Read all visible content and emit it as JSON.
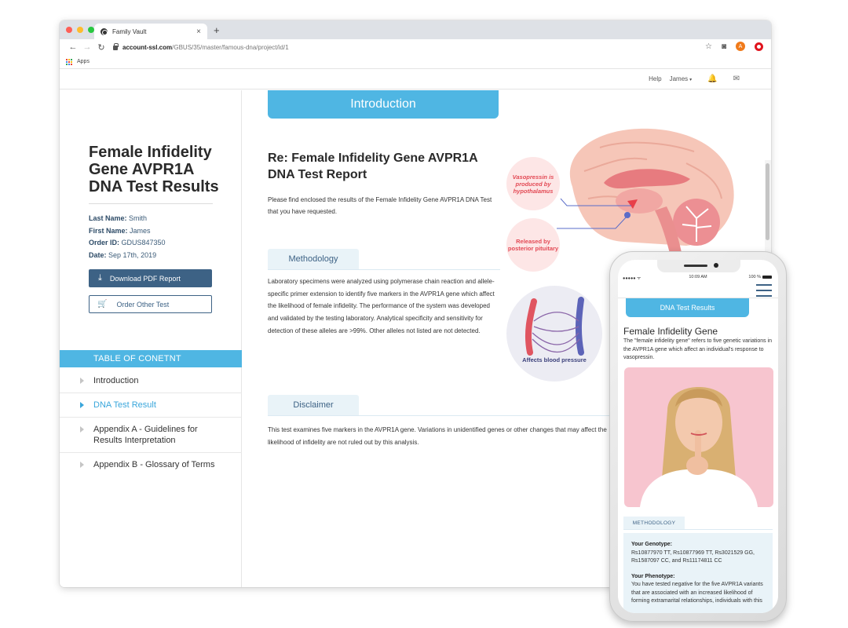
{
  "browser": {
    "tab_title": "Family Vault",
    "tab_close": "×",
    "new_tab": "+",
    "url_host": "account-ssl.com",
    "url_path": "/GBUS/35/master/famous-dna/project/id/1",
    "profile_initial": "A",
    "bookmarks": {
      "apps_label": "Apps"
    },
    "icons": {
      "back": "←",
      "forward": "→",
      "reload": "↻",
      "star": "☆",
      "camera": "◙"
    }
  },
  "header": {
    "help": "Help",
    "user": "James",
    "user_caret": "▾",
    "bell": "🔔",
    "mail": "✉"
  },
  "sidebar": {
    "title": "Female Infidelity Gene AVPR1A DNA Test Results",
    "meta": [
      {
        "label": "Last Name:",
        "value": "Smith"
      },
      {
        "label": "First Name:",
        "value": "James"
      },
      {
        "label": "Order ID:",
        "value": "GDUS847350"
      },
      {
        "label": "Date:",
        "value": "Sep 17th, 2019"
      }
    ],
    "download_button": "Download PDF Report",
    "order_button": "Order Other Test",
    "toc_heading": "TABLE OF CONETNT",
    "toc": [
      {
        "label": "Introduction",
        "active": false
      },
      {
        "label": "DNA Test Result",
        "active": true
      },
      {
        "label": "Appendix A - Guidelines for Results Interpretation",
        "active": false
      },
      {
        "label": "Appendix B - Glossary of Terms",
        "active": false
      }
    ]
  },
  "main": {
    "banner": "Introduction",
    "report_title": "Re: Female Infidelity Gene AVPR1A DNA Test Report",
    "intro_text": "Please find enclosed the results of the Female Infidelity Gene AVPR1A DNA Test that you have requested.",
    "methodology": {
      "heading": "Methodology",
      "text": "Laboratory specimens were analyzed using polymerase chain reaction and allele-specific primer extension to identify five markers in the AVPR1A gene which affect the likelihood of female infidelity. The performance of the system was developed and validated by the testing laboratory. Analytical specificity and sensitivity for detection of these alleles are >99%. Other alleles not listed are not detected."
    },
    "disclaimer": {
      "heading": "Disclaimer",
      "text": "This test examines five markers in the AVPR1A gene. Variations in unidentified genes or other changes that may affect the likelihood of infidelity are not ruled out by this analysis."
    },
    "illustrations": {
      "bubble_hypothalamus": "Vasopressin is produced by hypothalamus",
      "bubble_pituitary": "Released by posterior pituitary",
      "vessels_label": "Affects blood pressure"
    }
  },
  "phone": {
    "signal": "●●●●● ᯤ",
    "time": "10:09 AM",
    "battery": "100 %",
    "banner": "DNA Test Results",
    "title": "Female Infidelity Gene",
    "description": "The \"female infidelity gene\" refers to five genetic variations in the AVPR1A gene which affect an individual's response to vasopressin.",
    "methodology_tab": "METHODOLOGY",
    "genotype_label": "Your Genotype:",
    "genotype_value": "Rs10877970 TT, Rs10877969 TT, Rs3021529 GG, Rs1587097 CC, and Rs11174811 CC",
    "phenotype_label": "Your Phenotype:",
    "phenotype_value": "You have tested negative for the five AVPR1A variants that are associated with an increased likelihood of forming extramarital relationships, individuals with this"
  }
}
